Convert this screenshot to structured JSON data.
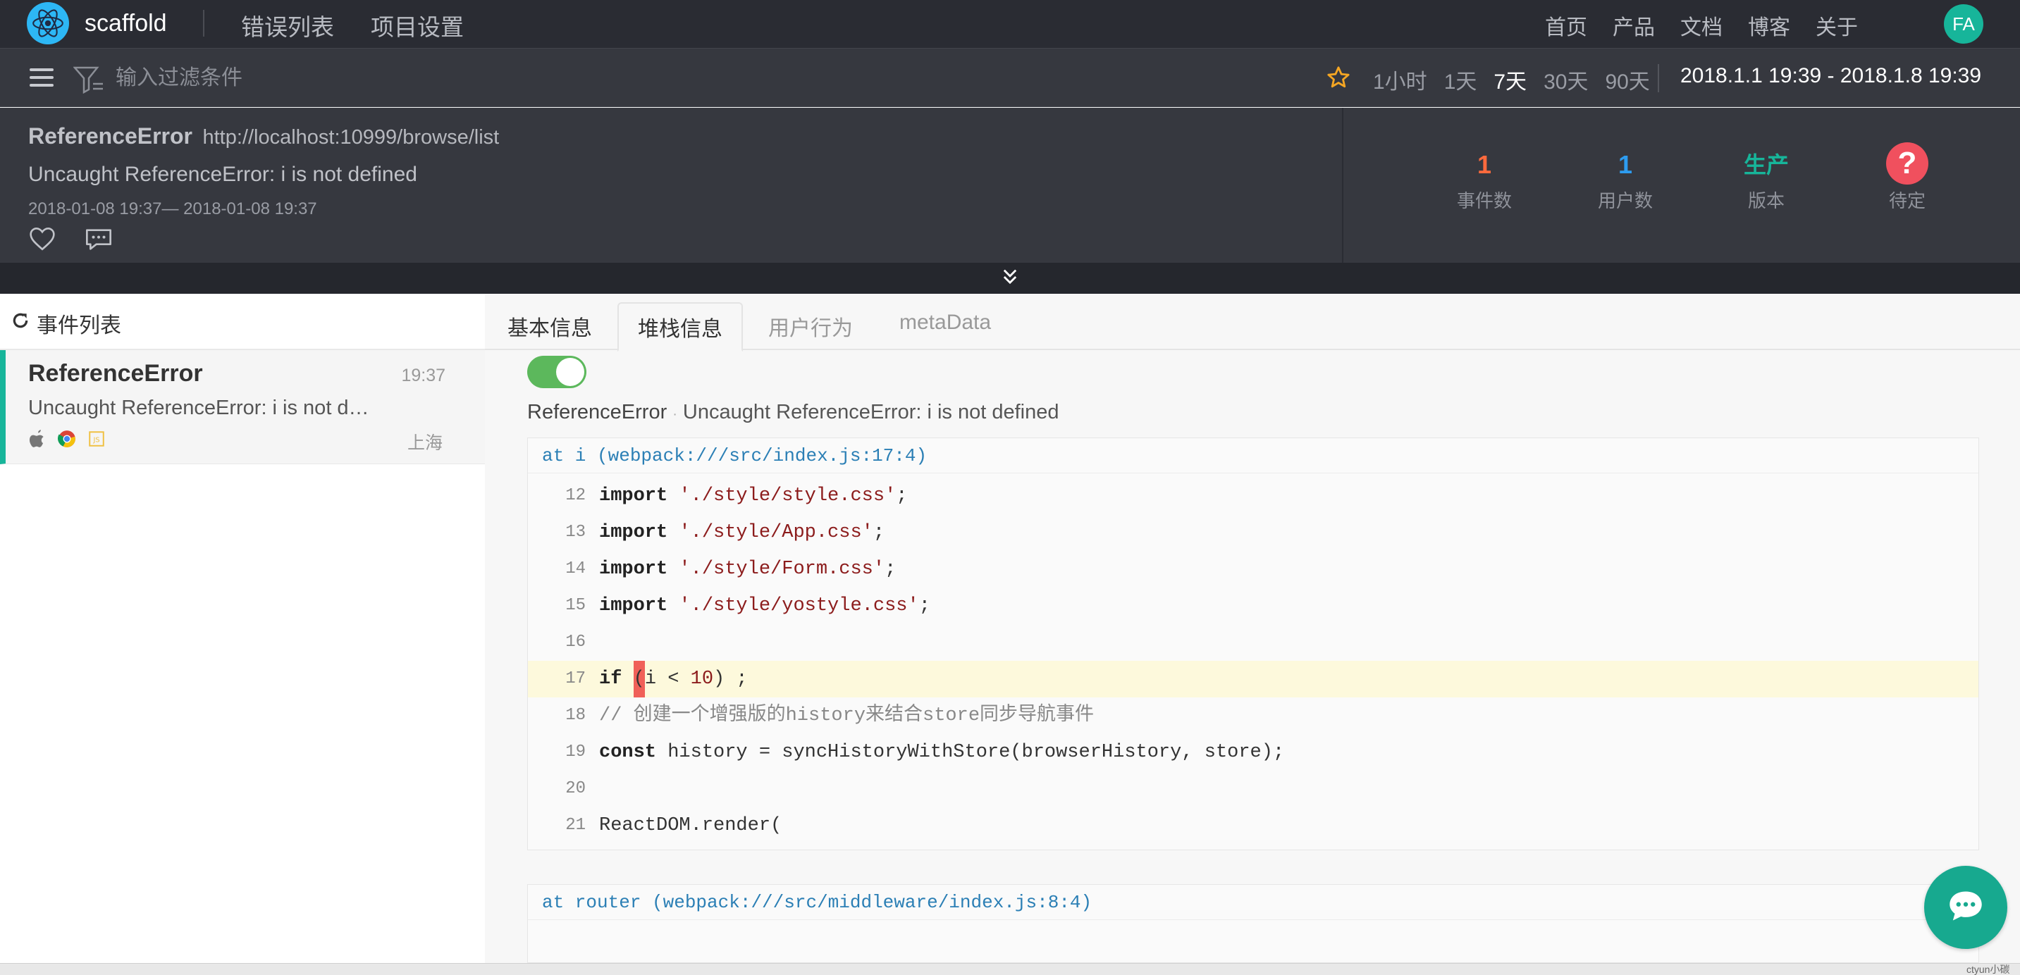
{
  "app": {
    "brand": "scaffold",
    "avatar": "FA"
  },
  "top_menu": [
    "错误列表",
    "项目设置"
  ],
  "right_menu": [
    "首页",
    "产品",
    "文档",
    "博客",
    "关于"
  ],
  "filter": {
    "placeholder": "输入过滤条件"
  },
  "time_ranges": {
    "items": [
      "1小时",
      "1天",
      "7天",
      "30天",
      "90天"
    ],
    "active": "7天"
  },
  "date_range": "2018.1.1 19:39 - 2018.1.8 19:39",
  "summary": {
    "type": "ReferenceError",
    "url": "http://localhost:10999/browse/list",
    "message": "Uncaught ReferenceError: i is not defined",
    "time": "2018-01-08 19:37— 2018-01-08 19:37",
    "stats": [
      {
        "value": "1",
        "label": "事件数",
        "color": "#ff6a3d"
      },
      {
        "value": "1",
        "label": "用户数",
        "color": "#2d9cf0"
      },
      {
        "value": "生产",
        "label": "版本",
        "color": "#17b59a"
      },
      {
        "value": "?",
        "label": "待定",
        "color": "#f0505e"
      }
    ]
  },
  "sidebar": {
    "header": "事件列表",
    "events": [
      {
        "title": "ReferenceError",
        "time": "19:37",
        "message": "Uncaught ReferenceError: i is not d…",
        "location": "上海"
      }
    ]
  },
  "tabs": [
    "基本信息",
    "堆栈信息",
    "用户行为",
    "metaData"
  ],
  "active_tab": "堆栈信息",
  "stack": {
    "error_type": "ReferenceError",
    "error_message": "Uncaught ReferenceError: i is not defined",
    "frames": [
      {
        "location": "at i (webpack:///src/index.js:17:4)",
        "lines": [
          {
            "n": "12",
            "code": "import './style/style.css';"
          },
          {
            "n": "13",
            "code": "import './style/App.css';"
          },
          {
            "n": "14",
            "code": "import './style/Form.css';"
          },
          {
            "n": "15",
            "code": "import './style/yostyle.css';"
          },
          {
            "n": "16",
            "code": ""
          },
          {
            "n": "17",
            "code": "if (i < 10) ;"
          },
          {
            "n": "18",
            "code": "// 创建一个增强版的history来结合store同步导航事件"
          },
          {
            "n": "19",
            "code": "const history = syncHistoryWithStore(browserHistory, store);"
          },
          {
            "n": "20",
            "code": ""
          },
          {
            "n": "21",
            "code": "ReactDOM.render("
          }
        ]
      },
      {
        "location": "at router (webpack:///src/middleware/index.js:8:4)"
      }
    ]
  },
  "watermark": "ctyun小碳"
}
